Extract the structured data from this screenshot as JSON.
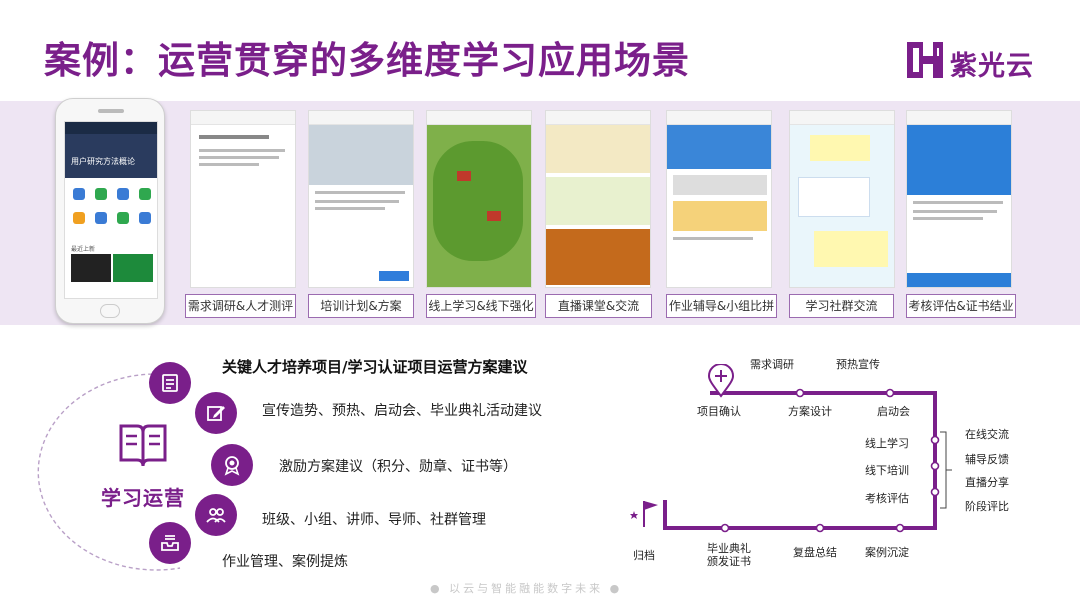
{
  "header": {
    "title": "案例：运营贯穿的多维度学习应用场景",
    "brand": "紫光云"
  },
  "colors": {
    "brand": "#7a1f8a",
    "band": "#eee5f3"
  },
  "screens": [
    {
      "caption": "需求调研&人才测评",
      "icon": "survey-screenshot"
    },
    {
      "caption": "培训计划&方案",
      "icon": "plan-screenshot"
    },
    {
      "caption": "线上学习&线下强化",
      "icon": "map-screenshot"
    },
    {
      "caption": "直播课堂&交流",
      "icon": "live-screenshot"
    },
    {
      "caption": "作业辅导&小组比拼",
      "icon": "homework-screenshot"
    },
    {
      "caption": "学习社群交流",
      "icon": "community-screenshot"
    },
    {
      "caption": "考核评估&证书结业",
      "icon": "exam-screenshot"
    }
  ],
  "phone_screen": {
    "banner": "用户研究方法概论",
    "news": "最近上新"
  },
  "operations": {
    "heading": "关键人才培养项目/学习认证项目运营方案建议",
    "center": "学习运营",
    "items": [
      {
        "text": "宣传造势、预热、启动会、毕业典礼活动建议",
        "icon": "edit-icon"
      },
      {
        "text": "激励方案建议（积分、勋章、证书等）",
        "icon": "medal-icon"
      },
      {
        "text": "班级、小组、讲师、导师、社群管理",
        "icon": "group-icon"
      },
      {
        "text": "作业管理、案例提炼",
        "icon": "inbox-icon"
      }
    ]
  },
  "flow": {
    "top": [
      "需求调研",
      "预热宣传"
    ],
    "main": [
      "项目确认",
      "方案设计",
      "启动会"
    ],
    "middle": [
      "线上学习",
      "线下培训",
      "考核评估"
    ],
    "side": [
      "在线交流",
      "辅导反馈",
      "直播分享",
      "阶段评比"
    ],
    "bottom": [
      "归档",
      "毕业典礼\n颁发证书",
      "复盘总结",
      "案例沉淀"
    ]
  },
  "footer": "● 以云与智能融能数字未来 ●"
}
